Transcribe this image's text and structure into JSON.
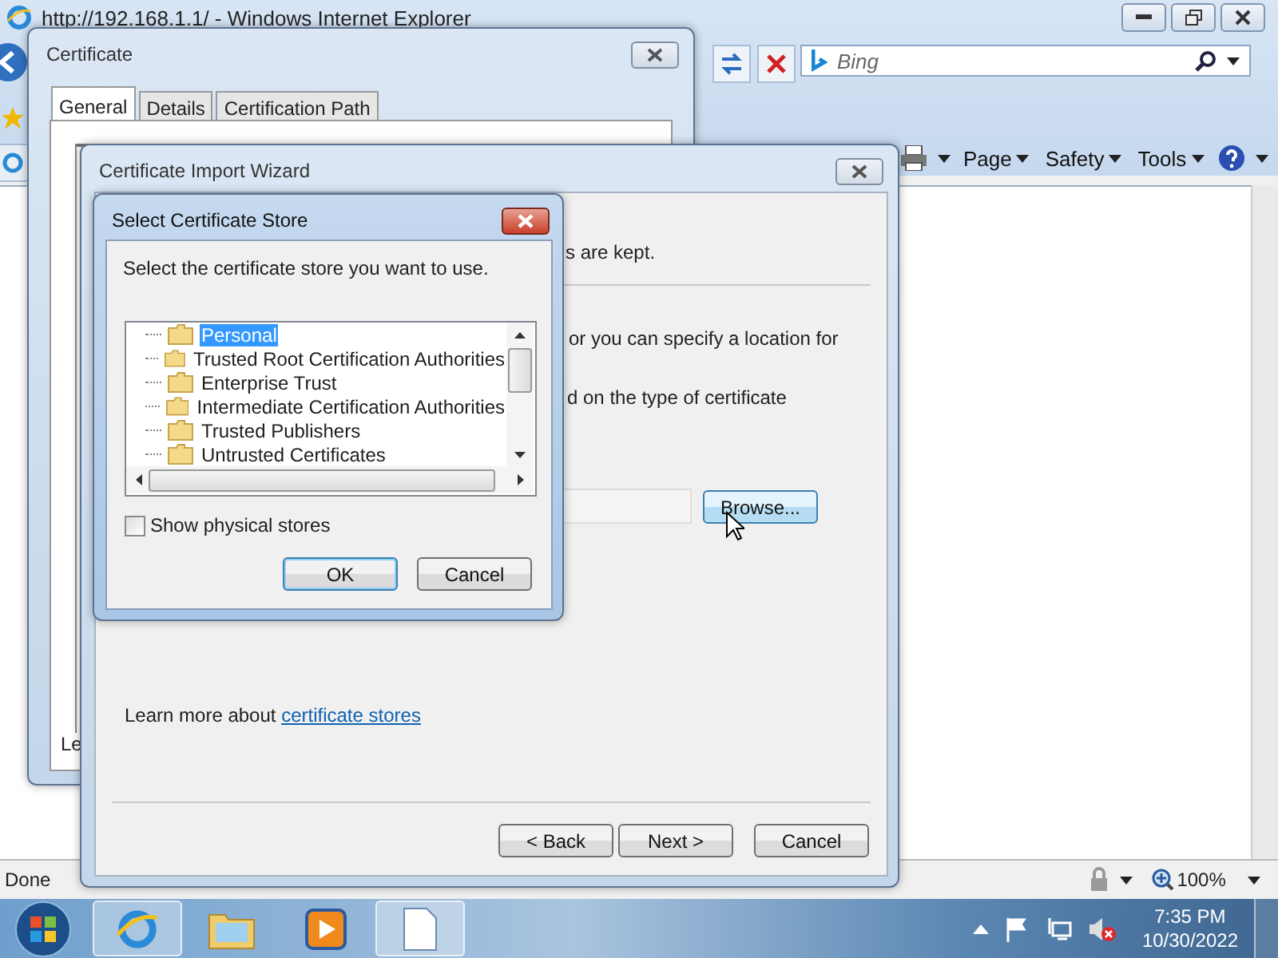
{
  "browser": {
    "title": "http://192.168.1.1/ - Windows Internet Explorer",
    "search": {
      "placeholder": "Bing"
    },
    "menus": [
      "Page",
      "Safety",
      "Tools"
    ],
    "status": "Done",
    "zoom": "100%"
  },
  "certificate_window": {
    "title": "Certificate",
    "tabs": [
      {
        "label": "General",
        "selected": true
      },
      {
        "label": "Details",
        "selected": false
      },
      {
        "label": "Certification Path",
        "selected": false
      }
    ],
    "fragment": "Le"
  },
  "wizard": {
    "title": "Certificate Import Wizard",
    "fragments": [
      "s are kept.",
      "or you can specify a location for",
      "d on the type of certificate"
    ],
    "browse_button": "Browse...",
    "learn_more": "Learn more about",
    "link": "certificate stores",
    "buttons": [
      "< Back",
      "Next >",
      "Cancel"
    ]
  },
  "store_dialog": {
    "title": "Select Certificate Store",
    "prompt": "Select the certificate store you want to use.",
    "stores": [
      {
        "label": "Personal",
        "selected": true
      },
      {
        "label": "Trusted Root Certification Authorities",
        "selected": false
      },
      {
        "label": "Enterprise Trust",
        "selected": false
      },
      {
        "label": "Intermediate Certification Authorities",
        "selected": false
      },
      {
        "label": "Trusted Publishers",
        "selected": false
      },
      {
        "label": "Untrusted Certificates",
        "selected": false
      }
    ],
    "show_physical": {
      "label": "Show physical stores",
      "checked": false
    },
    "buttons": [
      "OK",
      "Cancel"
    ]
  },
  "taskbar": {
    "time": "7:35 PM",
    "date": "10/30/2022"
  }
}
